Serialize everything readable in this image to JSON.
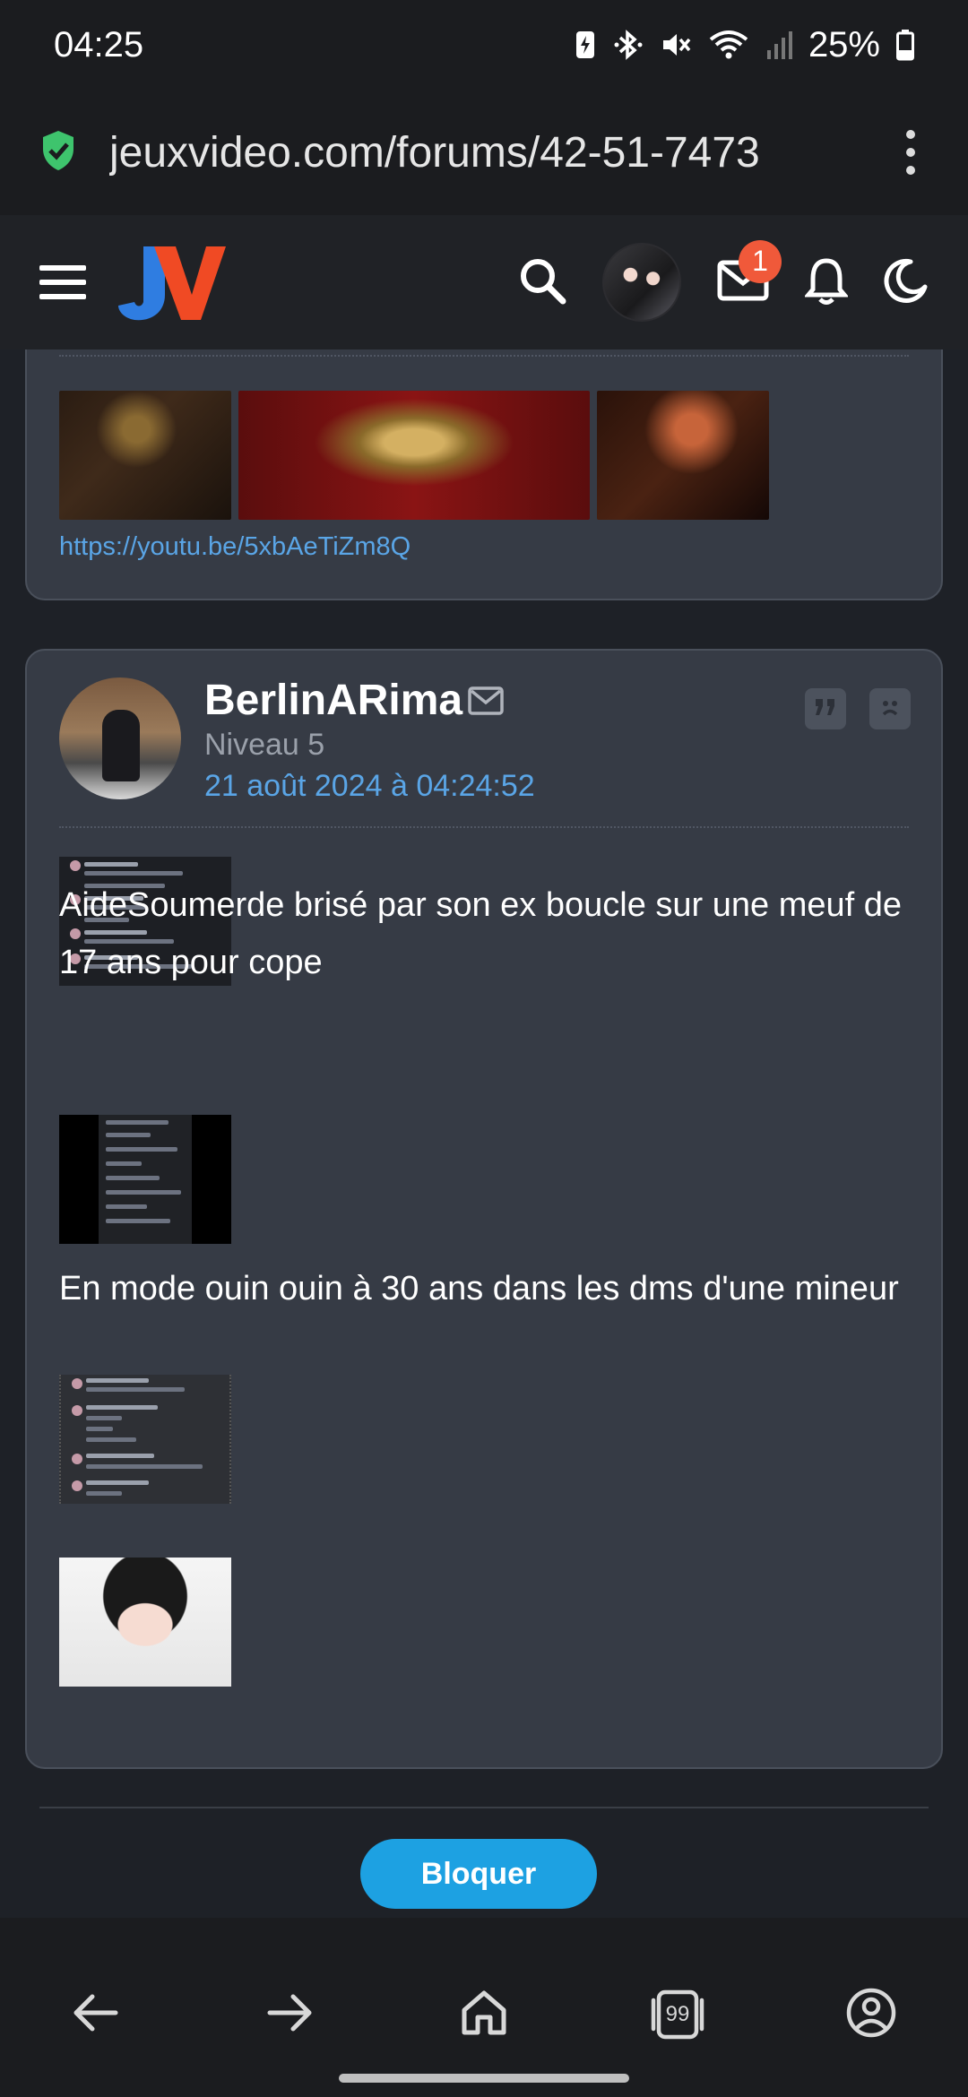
{
  "status_bar": {
    "time": "04:25",
    "battery": "25%",
    "icons": [
      "battery-saver-icon",
      "bluetooth-icon",
      "mute-icon",
      "wifi-icon",
      "signal-icon",
      "battery-icon"
    ]
  },
  "browser": {
    "url": "jeuxvideo.com/forums/42-51-7473",
    "secure_icon": "shield-check-icon"
  },
  "header": {
    "logo_text": "JV",
    "notification_count": "1",
    "icons": [
      "menu-icon",
      "search-icon",
      "mail-icon",
      "bell-icon",
      "moon-icon"
    ]
  },
  "previous_post": {
    "link": "https://youtu.be/5xbAeTiZm8Q"
  },
  "post": {
    "author": "BerlinARima",
    "level": "Niveau 5",
    "date": "21 août 2024 à 04:24:52",
    "text_1": "AideSoumerde brisé par son ex boucle sur une meuf de 17 ans pour cope",
    "text_2": "En mode ouin ouin à 30 ans dans les dms d'une mineur"
  },
  "actions": {
    "block_label": "Bloquer"
  },
  "bottom_nav": {
    "tab_count": "99",
    "icons": [
      "back-icon",
      "forward-icon",
      "home-icon",
      "tabs-icon",
      "profile-icon"
    ]
  },
  "colors": {
    "link": "#5aa5e6",
    "card": "#363b45",
    "badge": "#f0593a",
    "button": "#1da1e2"
  }
}
